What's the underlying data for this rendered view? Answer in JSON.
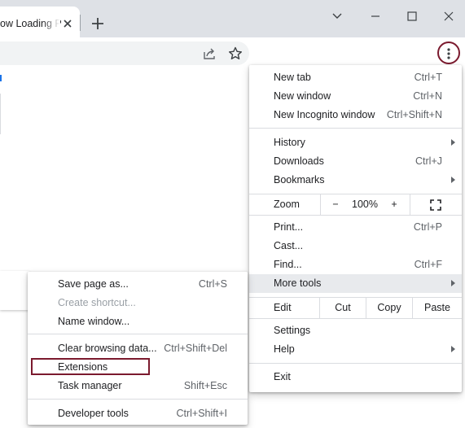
{
  "tab": {
    "title": "ow Loading P"
  },
  "colors": {
    "highlight_border": "#7b1a2e",
    "menu_hover": "#e8eaed",
    "tabstrip": "#dee1e6"
  },
  "main_menu": {
    "new_tab": {
      "label": "New tab",
      "shortcut": "Ctrl+T"
    },
    "new_window": {
      "label": "New window",
      "shortcut": "Ctrl+N"
    },
    "new_incognito": {
      "label": "New Incognito window",
      "shortcut": "Ctrl+Shift+N"
    },
    "history": {
      "label": "History"
    },
    "downloads": {
      "label": "Downloads",
      "shortcut": "Ctrl+J"
    },
    "bookmarks": {
      "label": "Bookmarks"
    },
    "zoom": {
      "label": "Zoom",
      "minus": "−",
      "value": "100%",
      "plus": "+"
    },
    "print": {
      "label": "Print...",
      "shortcut": "Ctrl+P"
    },
    "cast": {
      "label": "Cast..."
    },
    "find": {
      "label": "Find...",
      "shortcut": "Ctrl+F"
    },
    "more_tools": {
      "label": "More tools"
    },
    "edit": {
      "label": "Edit",
      "cut": "Cut",
      "copy": "Copy",
      "paste": "Paste"
    },
    "settings": {
      "label": "Settings"
    },
    "help": {
      "label": "Help"
    },
    "exit": {
      "label": "Exit"
    }
  },
  "more_tools_menu": {
    "save_page": {
      "label": "Save page as...",
      "shortcut": "Ctrl+S"
    },
    "create_shortcut": {
      "label": "Create shortcut..."
    },
    "name_window": {
      "label": "Name window..."
    },
    "clear_browsing": {
      "label": "Clear browsing data...",
      "shortcut": "Ctrl+Shift+Del"
    },
    "extensions": {
      "label": "Extensions"
    },
    "task_manager": {
      "label": "Task manager",
      "shortcut": "Shift+Esc"
    },
    "developer_tools": {
      "label": "Developer tools",
      "shortcut": "Ctrl+Shift+I"
    }
  }
}
